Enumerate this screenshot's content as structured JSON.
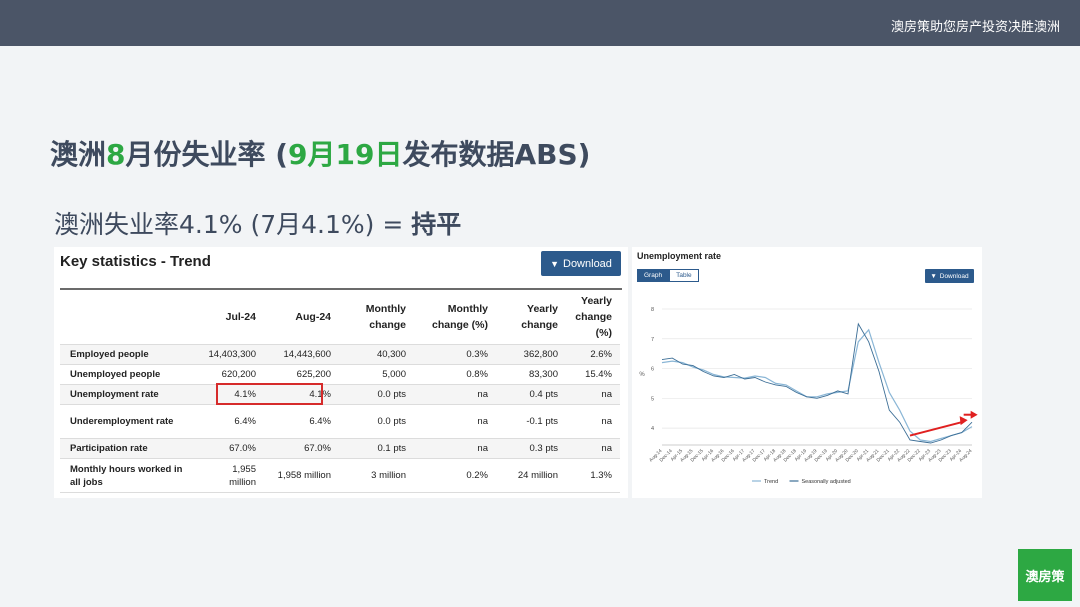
{
  "header": {
    "brand": "澳房策助您房产投资决胜澳洲"
  },
  "slide": {
    "title_p1": "澳洲",
    "title_p2": "8",
    "title_p3": "月份失业率 (",
    "title_p4": "9月19日",
    "title_p5": "发布数据ABS)",
    "subtitle_main": "澳洲失业率4.1% (7月4.1%) = ",
    "subtitle_bold": "持平"
  },
  "key_stats": {
    "title": "Key statistics - Trend",
    "download_label": "Download",
    "columns": [
      "",
      "Jul-24",
      "Aug-24",
      "Monthly change",
      "Monthly change (%)",
      "Yearly change",
      "Yearly change (%)"
    ],
    "rows": [
      {
        "label": "Employed people",
        "values": [
          "14,403,300",
          "14,443,600",
          "40,300",
          "0.3%",
          "362,800",
          "2.6%"
        ]
      },
      {
        "label": "Unemployed people",
        "values": [
          "620,200",
          "625,200",
          "5,000",
          "0.8%",
          "83,300",
          "15.4%"
        ]
      },
      {
        "label": "Unemployment rate",
        "values": [
          "4.1%",
          "4.1%",
          "0.0 pts",
          "na",
          "0.4 pts",
          "na"
        ]
      },
      {
        "label": "Underemployment rate",
        "values": [
          "6.4%",
          "6.4%",
          "0.0 pts",
          "na",
          "-0.1 pts",
          "na"
        ]
      },
      {
        "label": "Participation rate",
        "values": [
          "67.0%",
          "67.0%",
          "0.1 pts",
          "na",
          "0.3 pts",
          "na"
        ]
      },
      {
        "label": "Monthly hours worked in all jobs",
        "values": [
          "1,955 million",
          "1,958 million",
          "3 million",
          "0.2%",
          "24 million",
          "1.3%"
        ]
      }
    ]
  },
  "chart_panel": {
    "title": "Unemployment rate",
    "tab_graph": "Graph",
    "tab_table": "Table",
    "download_label": "Download"
  },
  "chart_data": {
    "type": "line",
    "title": "Unemployment rate",
    "xlabel": "",
    "ylabel": "%",
    "ylim": [
      3.5,
      8
    ],
    "yticks": [
      4,
      5,
      6,
      7,
      8
    ],
    "xticks": [
      "Aug-14",
      "Dec-14",
      "Apr-15",
      "Aug-15",
      "Dec-15",
      "Apr-16",
      "Aug-16",
      "Dec-16",
      "Apr-17",
      "Aug-17",
      "Dec-17",
      "Apr-18",
      "Aug-18",
      "Dec-18",
      "Apr-19",
      "Aug-19",
      "Dec-19",
      "Apr-20",
      "Aug-20",
      "Dec-20",
      "Apr-21",
      "Aug-21",
      "Dec-21",
      "Apr-22",
      "Aug-22",
      "Dec-22",
      "Apr-23",
      "Aug-23",
      "Dec-23",
      "Apr-24",
      "Aug-24"
    ],
    "grid": true,
    "legend": "bottom",
    "series": [
      {
        "name": "Trend",
        "color": "#8ab6d6",
        "values": [
          6.2,
          6.25,
          6.2,
          6.05,
          5.95,
          5.8,
          5.72,
          5.7,
          5.68,
          5.75,
          5.7,
          5.5,
          5.45,
          5.25,
          5.05,
          5.05,
          5.15,
          5.2,
          5.25,
          6.9,
          7.3,
          6.2,
          5.2,
          4.6,
          3.9,
          3.6,
          3.55,
          3.65,
          3.75,
          3.85,
          4.05
        ]
      },
      {
        "name": "Seasonally adjusted",
        "color": "#3c6e96",
        "values": [
          6.3,
          6.35,
          6.15,
          6.1,
          5.9,
          5.75,
          5.7,
          5.8,
          5.65,
          5.7,
          5.55,
          5.45,
          5.4,
          5.2,
          5.05,
          5.0,
          5.1,
          5.25,
          5.15,
          7.5,
          6.9,
          5.9,
          4.6,
          4.2,
          3.6,
          3.55,
          3.5,
          3.6,
          3.75,
          3.85,
          4.2
        ]
      }
    ],
    "annotation": "upward-trend-arrow"
  },
  "logo": {
    "text": "澳房策"
  },
  "colors": {
    "accent_green": "#2da843",
    "header_bar": "#4b5567",
    "abs_blue": "#2c5a8c",
    "highlight_red": "#d62b2b"
  }
}
